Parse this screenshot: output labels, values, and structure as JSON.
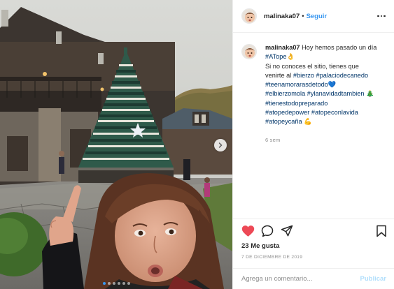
{
  "post": {
    "username": "malinaka07",
    "separator": "•",
    "follow_label": "Seguir",
    "more_icon": "more-horizontal-icon"
  },
  "caption": {
    "username": "malinaka07",
    "line1": "Hoy hemos pasado un día",
    "tag_atope": "#ATope👌",
    "line2": "Si no conoces el sitio, tienes que",
    "line3_text": "venirte al",
    "tag_bierzo": "#bierzo",
    "tag_palacio": "#palaciodecanedo",
    "tag_teenamoraras": "#teenamorarasdetodo",
    "emoji_heart": "💙",
    "tag_elbierzomola": "#elbierzomola",
    "tag_ylanavidad": "#ylanavidadtambien",
    "emoji_tree": "🎄",
    "tag_tienestodo": "#tienestodopreparado",
    "tag_atopedepower": "#atopedepower",
    "tag_atopeconlavida": "#atopeconlavida",
    "tag_atopeycana": "#atopeycaña",
    "emoji_muscle": "💪",
    "time_ago": "6 sem"
  },
  "actions": {
    "like_icon": "heart-icon",
    "comment_icon": "comment-icon",
    "share_icon": "share-icon",
    "save_icon": "bookmark-icon",
    "like_color": "#ed4956"
  },
  "likes_text": "23 Me gusta",
  "date_text": "7 DE DICIEMBRE DE 2019",
  "comment": {
    "placeholder": "Agrega un comentario...",
    "publish_label": "Publicar"
  },
  "carousel": {
    "next_icon": "chevron-right-icon",
    "total_slides": 6,
    "active_slide": 1
  },
  "colors": {
    "link": "#003569",
    "follow": "#3897f0",
    "publish_disabled": "#b2dffc"
  }
}
